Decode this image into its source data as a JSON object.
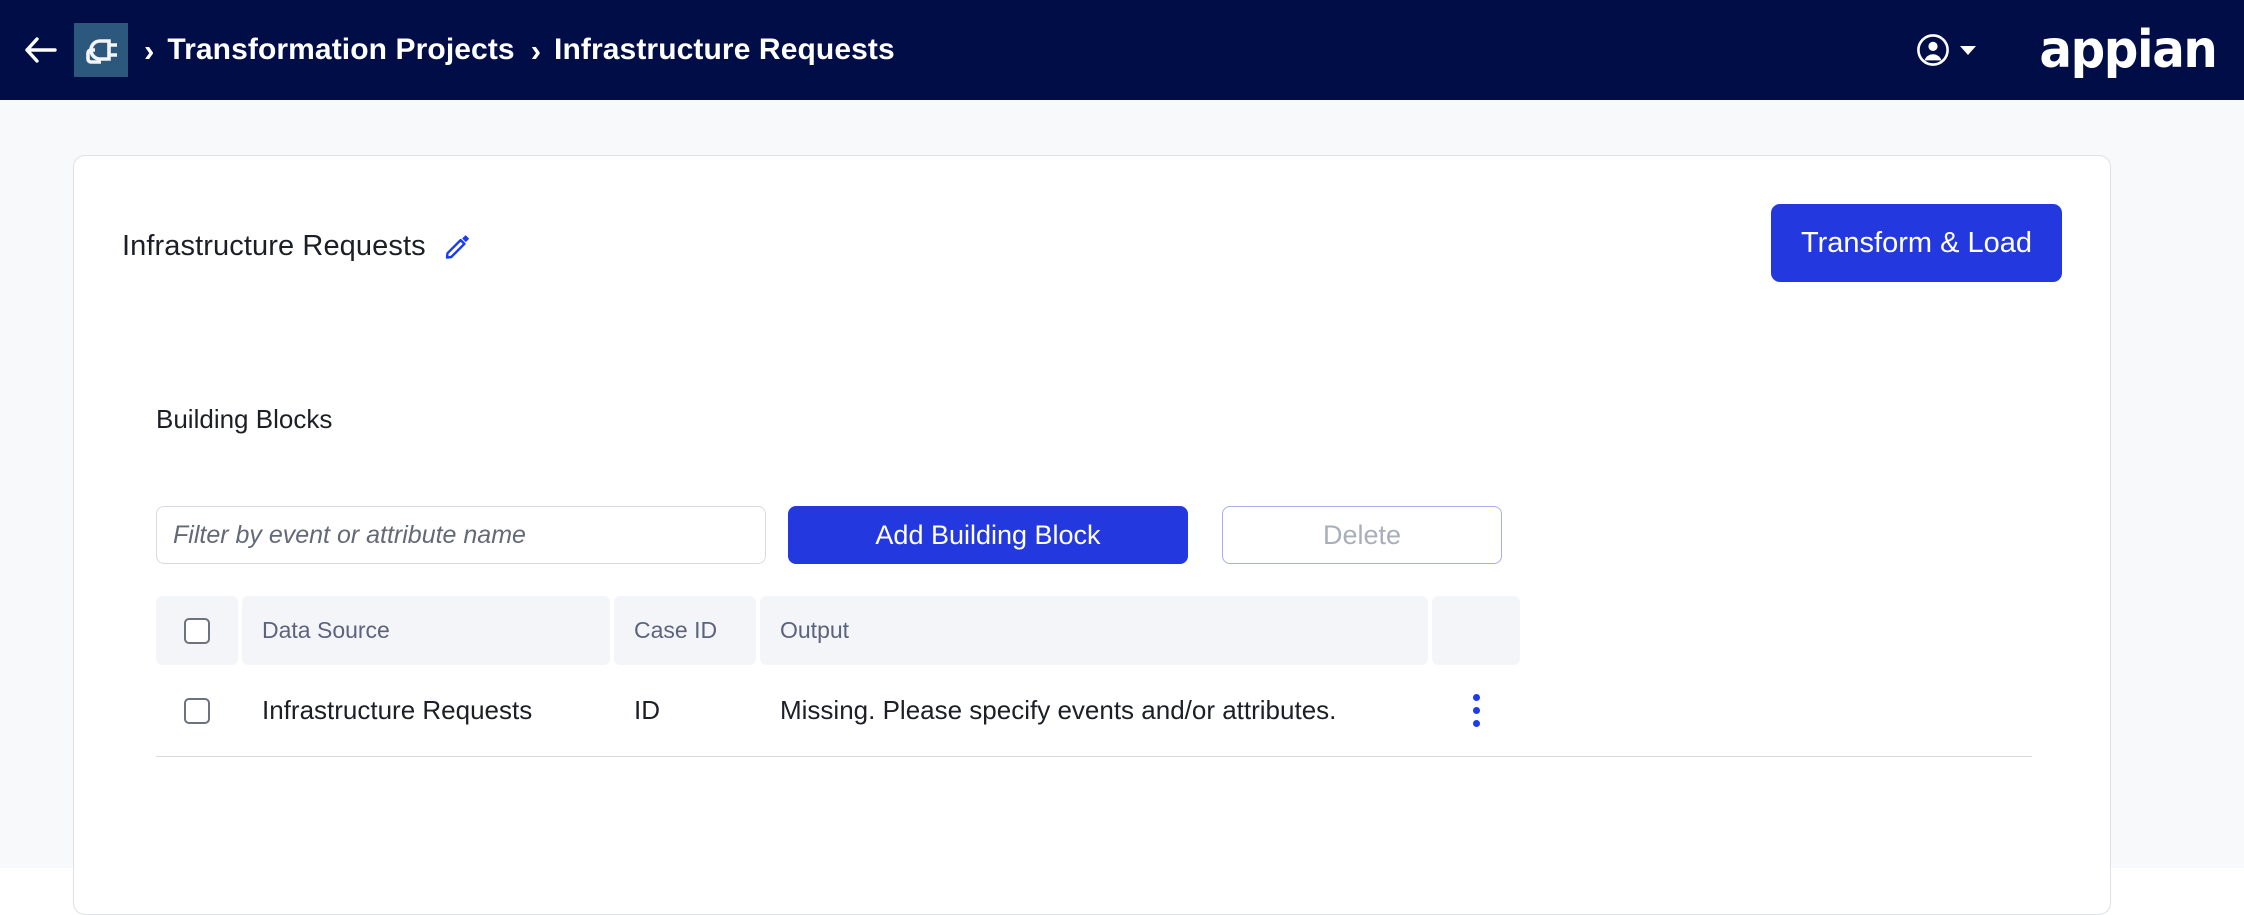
{
  "topbar": {
    "back_icon": "arrow-left-icon",
    "app_icon": "plug-connector-icon",
    "separator": "›",
    "breadcrumb": [
      {
        "label": "Transformation Projects"
      },
      {
        "label": "Infrastructure Requests"
      }
    ],
    "account_icon": "user-account-icon",
    "brand": "appian",
    "background_color": "#000D47",
    "logo_tile_color": "#2B587C"
  },
  "card": {
    "title": "Infrastructure Requests",
    "edit_icon": "pencil-edit-icon",
    "primary_action": "Transform & Load",
    "section_heading": "Building Blocks"
  },
  "controls": {
    "filter_placeholder": "Filter by event or attribute name",
    "filter_value": "",
    "add_label": "Add Building Block",
    "delete_label": "Delete",
    "delete_disabled": true
  },
  "table": {
    "columns": [
      "",
      "Data Source",
      "Case ID",
      "Output",
      ""
    ],
    "rows": [
      {
        "selected": false,
        "data_source": "Infrastructure Requests",
        "case_id": "ID",
        "output": "Missing. Please specify events and/or attributes.",
        "menu_icon": "kebab-menu-icon"
      }
    ]
  },
  "colors": {
    "accent_blue": "#2438E0",
    "nav_navy": "#000D47",
    "header_cell_bg": "#F4F5F8",
    "disabled_text": "#A9AEBB"
  }
}
